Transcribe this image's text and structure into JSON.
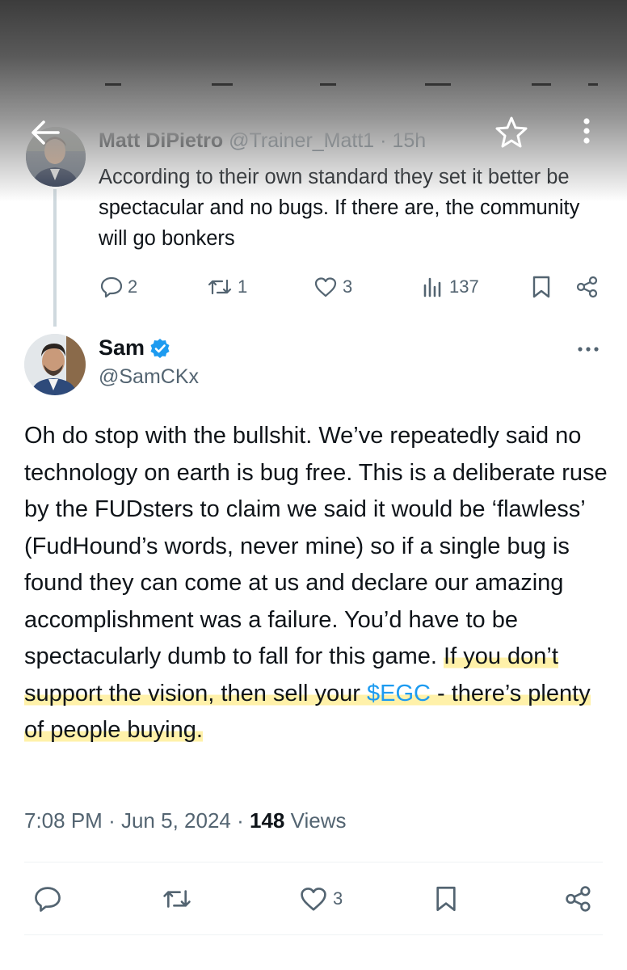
{
  "nav": {
    "back_icon": "arrow-left-icon",
    "star_icon": "star-outline-icon",
    "more_icon": "more-vertical-icon"
  },
  "reply": {
    "name": "Matt DiPietro",
    "handle": "@Trainer_Matt1",
    "separator": "·",
    "time": "15h",
    "text": "According to their own standard they set it better be spectacular and no bugs. If there are, the community will go bonkers",
    "replies": "2",
    "retweets": "1",
    "likes": "3",
    "views": "137"
  },
  "tweet": {
    "name": "Sam",
    "handle": "@SamCKx",
    "verified": true,
    "text_part1": "Oh do stop with the bullshit. We’ve repeatedly said no technology on earth is bug free. This is a deliberate ruse by the FUDsters to claim we said it would be ‘flawless’ (FudHound’s words, never mine) so if a single bug is found they can come at us and declare our amazing accomplishment was a failure. You’d have to be spectacularly dumb to fall for this game.",
    "text_highlight1": "If you don’t support the vision, then sell your",
    "cashtag": "$EGC",
    "text_highlight2": "- there’s plenty of people buying.",
    "time": "7:08 PM",
    "separator": "·",
    "date": "Jun 5, 2024",
    "views_count": "148",
    "views_label": "Views",
    "likes": "3"
  },
  "colors": {
    "accent": "#1d9bf0",
    "muted": "#536471",
    "text": "#0f1419",
    "highlight": "#ffec8c"
  }
}
